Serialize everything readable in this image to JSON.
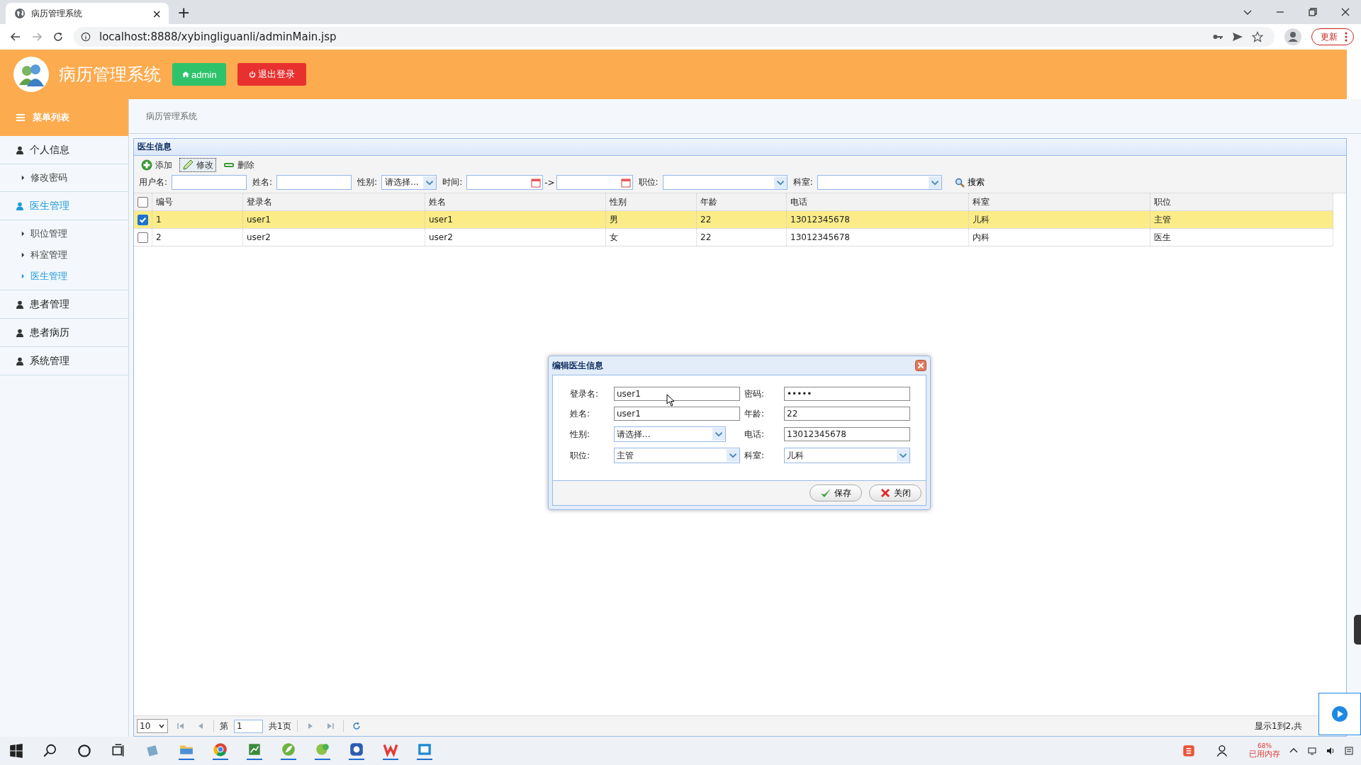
{
  "browser": {
    "tab_title": "病历管理系统",
    "tab_close": "×",
    "new_tab": "+",
    "url": "localhost:8888/xybingliguanli/adminMain.jsp",
    "update_button": "更新"
  },
  "header": {
    "title": "病历管理系统",
    "user_button": "admin",
    "logout_button": "退出登录"
  },
  "sidebar": {
    "title": "菜单列表",
    "groups": [
      {
        "label": "个人信息",
        "selected": false,
        "children": [
          {
            "label": "修改密码",
            "selected": false
          }
        ]
      },
      {
        "label": "医生管理",
        "selected": true,
        "children": [
          {
            "label": "职位管理",
            "selected": false
          },
          {
            "label": "科室管理",
            "selected": false
          },
          {
            "label": "医生管理",
            "selected": true
          }
        ]
      },
      {
        "label": "患者管理",
        "selected": false
      },
      {
        "label": "患者病历",
        "selected": false
      },
      {
        "label": "系统管理",
        "selected": false
      }
    ]
  },
  "breadcrumb": "病历管理系统",
  "panel": {
    "title": "医生信息",
    "toolbar": [
      {
        "label": "添加",
        "kind": "add",
        "focused": false
      },
      {
        "label": "修改",
        "kind": "edit",
        "focused": true
      },
      {
        "label": "删除",
        "kind": "delete",
        "focused": false
      }
    ],
    "filters": [
      {
        "label": "用户名:",
        "kind": "text"
      },
      {
        "label": "姓名:",
        "kind": "text"
      },
      {
        "label": "性别:",
        "kind": "select",
        "value": "请选择..."
      },
      {
        "label": "时间:",
        "kind": "daterange",
        "separator": "->"
      },
      {
        "label": "职位:",
        "kind": "select"
      },
      {
        "label": "科室:",
        "kind": "select"
      }
    ],
    "search_button": "搜索",
    "table": {
      "select_all_checked": false,
      "columns": [
        "编号",
        "登录名",
        "姓名",
        "性别",
        "年龄",
        "电话",
        "科室",
        "职位"
      ],
      "rows": [
        {
          "checked": true,
          "selected": true,
          "cells": [
            "1",
            "user1",
            "user1",
            "男",
            "22",
            "13012345678",
            "儿科",
            "主管"
          ]
        },
        {
          "checked": false,
          "selected": false,
          "cells": [
            "2",
            "user2",
            "user2",
            "女",
            "22",
            "13012345678",
            "内科",
            "医生"
          ]
        }
      ]
    },
    "pager": {
      "page_size": "10",
      "page_prefix": "第",
      "page": "1",
      "total_pages": "共1页",
      "summary": "显示1到2,共"
    }
  },
  "dialog": {
    "title": "编辑医生信息",
    "fields": [
      {
        "label": "登录名:",
        "kind": "text",
        "value": "user1"
      },
      {
        "label": "密码:",
        "kind": "text",
        "value": "•••••"
      },
      {
        "label": "姓名:",
        "kind": "text",
        "value": "user1"
      },
      {
        "label": "年龄:",
        "kind": "text",
        "value": "22"
      },
      {
        "label": "性别:",
        "kind": "select",
        "value": "请选择..."
      },
      {
        "label": "电话:",
        "kind": "text",
        "value": "13012345678"
      },
      {
        "label": "职位:",
        "kind": "select",
        "value": "主管"
      },
      {
        "label": "科室:",
        "kind": "select",
        "value": "儿科"
      }
    ],
    "buttons": [
      {
        "label": "保存",
        "kind": "save"
      },
      {
        "label": "关闭",
        "kind": "close"
      }
    ]
  },
  "taskbar": {
    "memory_value": "68%",
    "memory_label": "已用内存"
  }
}
